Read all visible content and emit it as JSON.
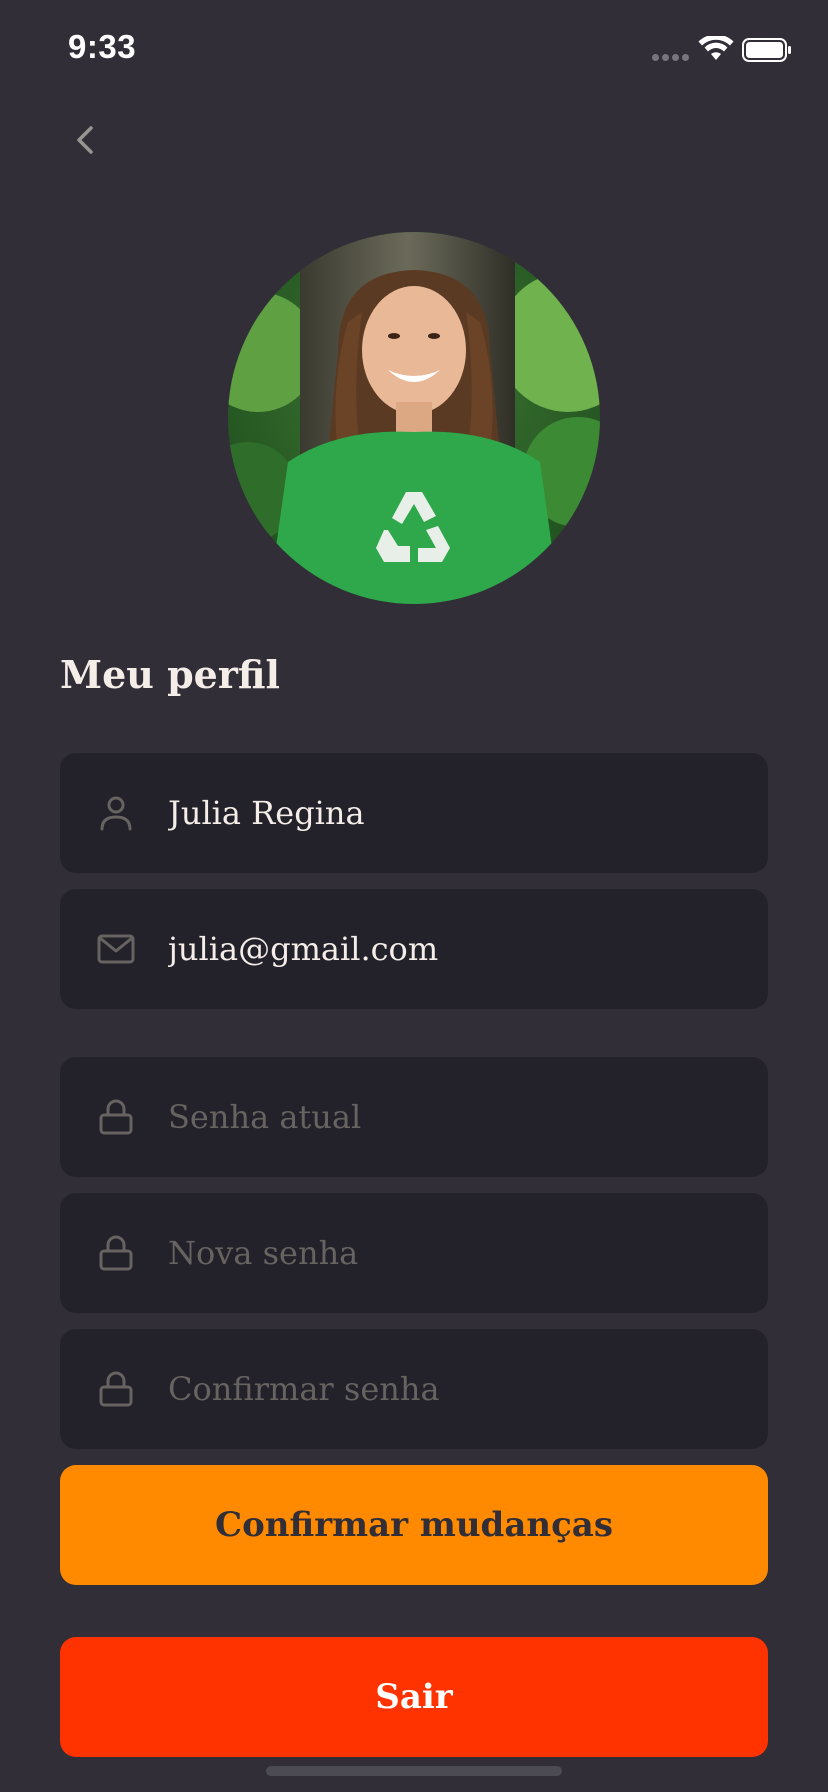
{
  "status_bar": {
    "time": "9:33",
    "icons": [
      "signal-dots-icon",
      "wifi-icon",
      "battery-icon"
    ]
  },
  "header": {
    "back_icon": "chevron-left-icon"
  },
  "profile": {
    "avatar_description": "profile-photo",
    "title": "Meu perfil"
  },
  "form": {
    "name": {
      "icon": "user-icon",
      "value": "Julia Regina"
    },
    "email": {
      "icon": "mail-icon",
      "value": "julia@gmail.com"
    },
    "current_password": {
      "icon": "lock-icon",
      "placeholder": "Senha atual"
    },
    "new_password": {
      "icon": "lock-icon",
      "placeholder": "Nova senha"
    },
    "confirm_password": {
      "icon": "lock-icon",
      "placeholder": "Confirmar senha"
    }
  },
  "actions": {
    "confirm_label": "Confirmar mudanças",
    "logout_label": "Sair"
  },
  "colors": {
    "background": "#312e38",
    "input_background": "#232129",
    "text": "#f4ede8",
    "placeholder": "#666360",
    "confirm_button": "#ff8a00",
    "logout_button": "#ff3300"
  }
}
